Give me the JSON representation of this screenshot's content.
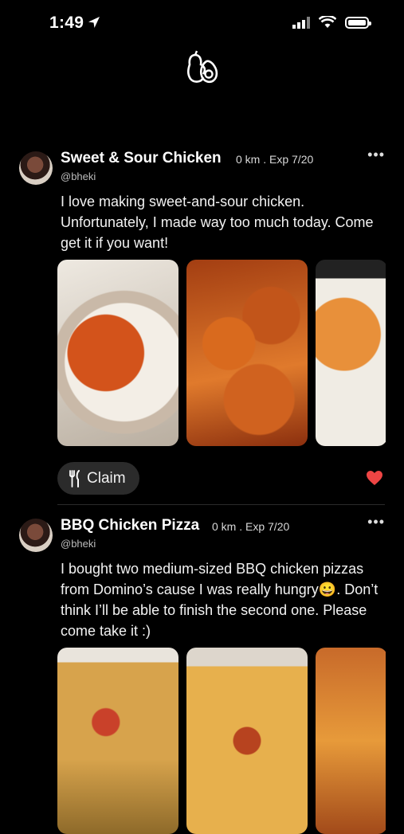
{
  "status": {
    "time": "1:49"
  },
  "posts": [
    {
      "title": "Sweet & Sour Chicken",
      "meta": "0 km . Exp 7/20",
      "handle": "@bheki",
      "body": "I love making sweet-and-sour chicken. Unfortunately, I made way too much today. Come get it if you want!",
      "claim_label": "Claim"
    },
    {
      "title": "BBQ Chicken Pizza",
      "meta": "0 km . Exp 7/20",
      "handle": "@bheki",
      "body": "I bought two medium-sized BBQ chicken pizzas from Domino’s cause I was really hungry😀. Don’t think I’ll be able to finish the second one. Please come take it :)"
    }
  ],
  "colors": {
    "like": "#ee4544",
    "background": "#000000",
    "claim_bg": "#2b2b2b"
  }
}
